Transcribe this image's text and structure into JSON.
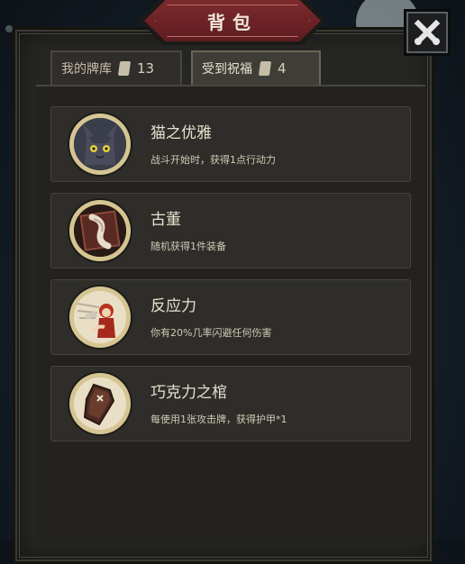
{
  "header": {
    "title": "背包"
  },
  "tabs": [
    {
      "label": "我的牌库",
      "count": "13"
    },
    {
      "label": "受到祝福",
      "count": "4"
    }
  ],
  "blessings": [
    {
      "name": "猫之优雅",
      "description": "战斗开始时，获得1点行动力",
      "icon": "cat-icon"
    },
    {
      "name": "古董",
      "description": "随机获得1件装备",
      "icon": "antique-scroll-icon"
    },
    {
      "name": "反应力",
      "description": "你有20%几率闪避任何伤害",
      "icon": "dodge-icon"
    },
    {
      "name": "巧克力之棺",
      "description": "每使用1张攻击牌，获得护甲*1",
      "icon": "coffin-icon"
    }
  ],
  "colors": {
    "title_banner": "#7c2a2d",
    "panel": "#262624",
    "portrait_ring": "#d5c592"
  }
}
